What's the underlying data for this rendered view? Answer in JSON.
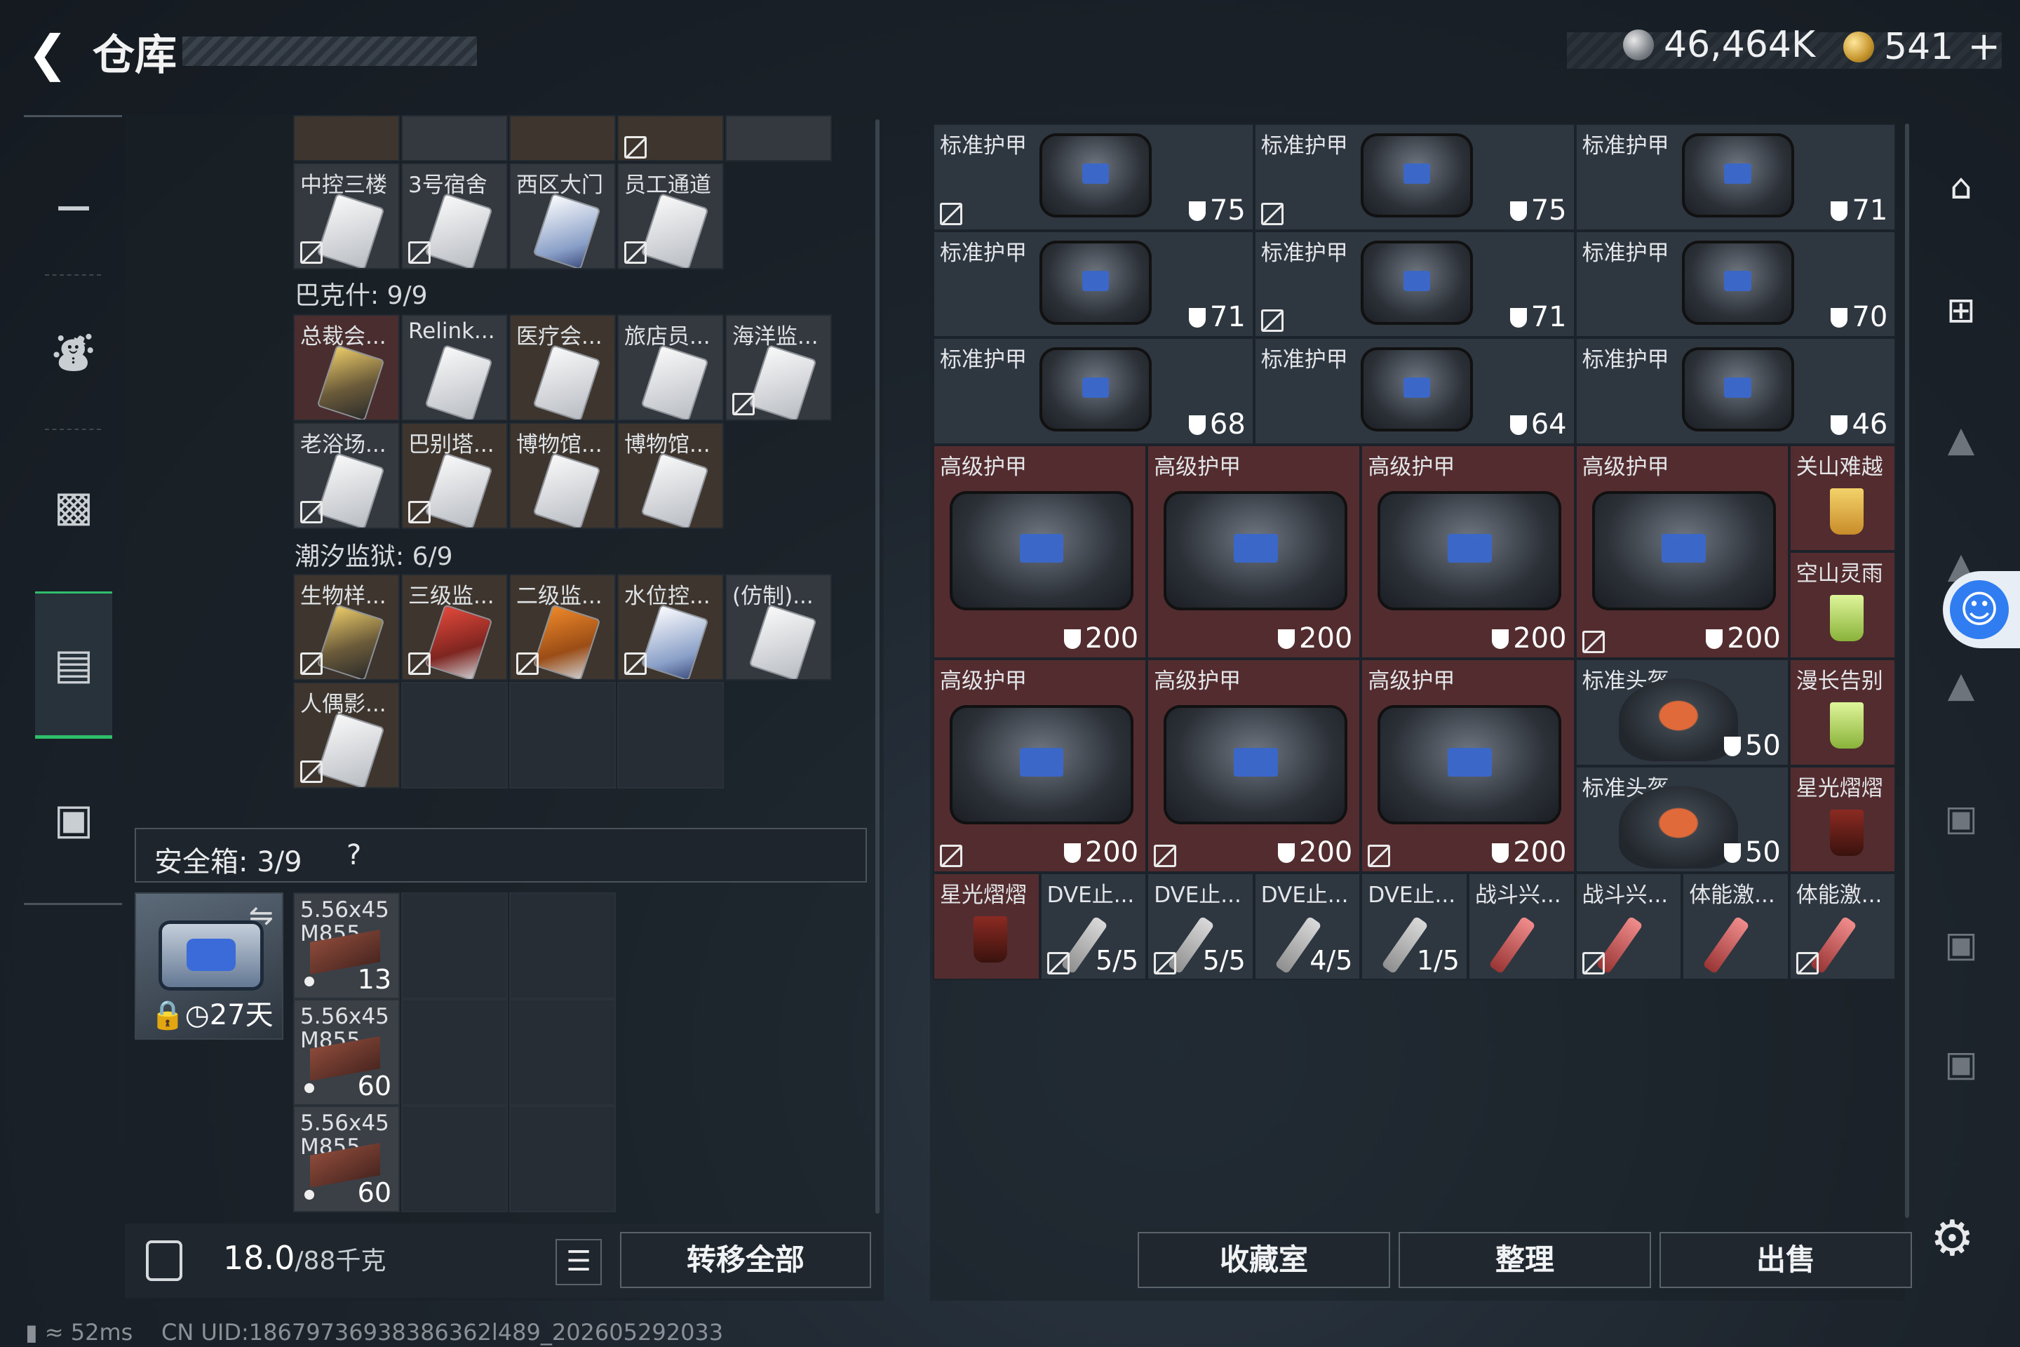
{
  "header": {
    "title": "仓库",
    "currency_silver": "46,464K",
    "currency_gold": "541",
    "currency_plus": "+"
  },
  "left_groups": {
    "top_row_labels": [
      "中控三楼",
      "3号宿舍",
      "西区大门",
      "员工通道"
    ],
    "group1_title": "巴克什: 9/9",
    "group1_labels": [
      "总裁会...",
      "Relink...",
      "医疗会...",
      "旅店员...",
      "海洋监...",
      "老浴场...",
      "巴别塔...",
      "博物馆...",
      "博物馆..."
    ],
    "group2_title": "潮汐监狱: 6/9",
    "group2_labels": [
      "生物样...",
      "三级监...",
      "二级监...",
      "水位控...",
      "(仿制)...",
      "人偶影..."
    ]
  },
  "safe": {
    "title": "安全箱: 3/9",
    "help": "?",
    "days": "27天",
    "swap_icon": "⇋"
  },
  "ammo": [
    {
      "name": "5.56x45 M855",
      "count": "13"
    },
    {
      "name": "5.56x45 M855",
      "count": "60"
    },
    {
      "name": "5.56x45 M855",
      "count": "60"
    }
  ],
  "footer": {
    "weight": "18.0",
    "weight_max": "/88千克",
    "transfer_all": "转移全部",
    "collection": "收藏室",
    "sort": "整理",
    "sell": "出售"
  },
  "standard_armor": [
    {
      "label": "标准护甲",
      "value": "75"
    },
    {
      "label": "标准护甲",
      "value": "75"
    },
    {
      "label": "标准护甲",
      "value": "71"
    },
    {
      "label": "标准护甲",
      "value": "71"
    },
    {
      "label": "标准护甲",
      "value": "71"
    },
    {
      "label": "标准护甲",
      "value": "70"
    },
    {
      "label": "标准护甲",
      "value": "68"
    },
    {
      "label": "标准护甲",
      "value": "64"
    },
    {
      "label": "标准护甲",
      "value": "46"
    }
  ],
  "advanced_armor": [
    {
      "label": "高级护甲",
      "value": "200"
    },
    {
      "label": "高级护甲",
      "value": "200"
    },
    {
      "label": "高级护甲",
      "value": "200"
    },
    {
      "label": "高级护甲",
      "value": "200"
    },
    {
      "label": "高级护甲",
      "value": "200"
    },
    {
      "label": "高级护甲",
      "value": "200"
    },
    {
      "label": "高级护甲",
      "value": "200"
    }
  ],
  "helmets": [
    {
      "label": "标准头盔",
      "value": "50"
    },
    {
      "label": "标准头盔",
      "value": "50"
    }
  ],
  "drinks": [
    "关山难越",
    "空山灵雨",
    "漫长告别",
    "星光熠熠"
  ],
  "bottom_row": [
    {
      "label": "星光熠熠",
      "count": ""
    },
    {
      "label": "DVE止...",
      "count": "5/5"
    },
    {
      "label": "DVE止...",
      "count": "5/5"
    },
    {
      "label": "DVE止...",
      "count": "4/5"
    },
    {
      "label": "DVE止...",
      "count": "1/5"
    },
    {
      "label": "战斗兴...",
      "count": ""
    },
    {
      "label": "战斗兴...",
      "count": ""
    },
    {
      "label": "体能激...",
      "count": ""
    },
    {
      "label": "体能激...",
      "count": ""
    }
  ],
  "status": {
    "ping": "52ms",
    "uid": "CN UID:18679736938386362l489_202605292033"
  },
  "colors": {
    "accent_green": "#2fbf6b",
    "armor_red_bg": "#522c2e",
    "access_blue": "#2f7df0"
  }
}
